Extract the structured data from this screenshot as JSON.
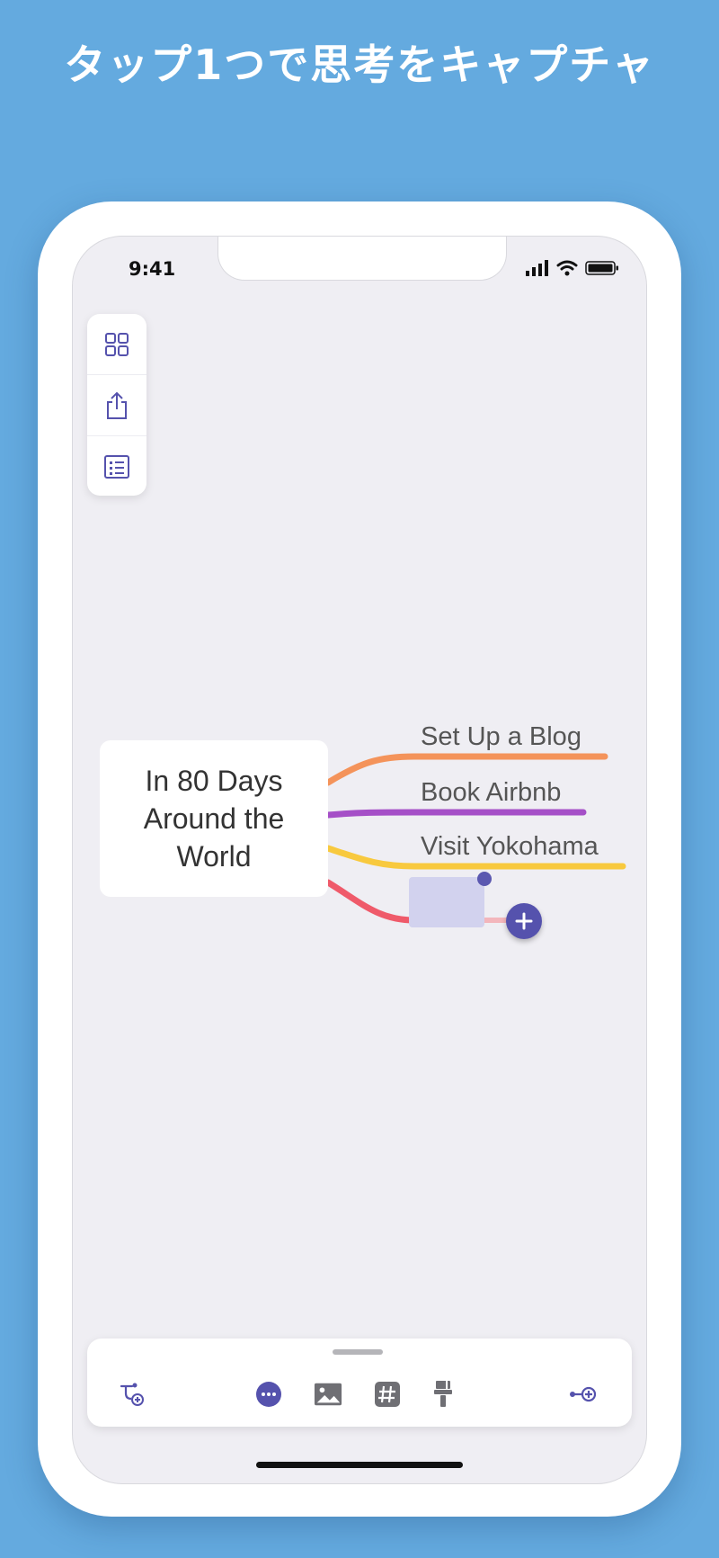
{
  "headline": "タップ1つで思考をキャプチャ",
  "status_bar": {
    "time": "9:41"
  },
  "side_toolbar": {
    "icons": [
      "grid-icon",
      "share-icon",
      "outline-list-icon"
    ]
  },
  "mind_map": {
    "central_topic": "In 80 Days Around the World",
    "branches": [
      {
        "label": "Set Up a Blog",
        "color": "#f4935a"
      },
      {
        "label": "Book Airbnb",
        "color": "#a54fc7"
      },
      {
        "label": "Visit Yokohama",
        "color": "#f8c93e"
      },
      {
        "label": "",
        "color": "#ef5a6a"
      }
    ]
  },
  "bottom_toolbar": {
    "icons": [
      "add-branch-icon",
      "more-options-icon",
      "image-icon",
      "tag-icon",
      "style-brush-icon",
      "add-sibling-icon"
    ]
  },
  "colors": {
    "background": "#64aadf",
    "accent": "#5552ad",
    "screen": "#efeef3"
  }
}
